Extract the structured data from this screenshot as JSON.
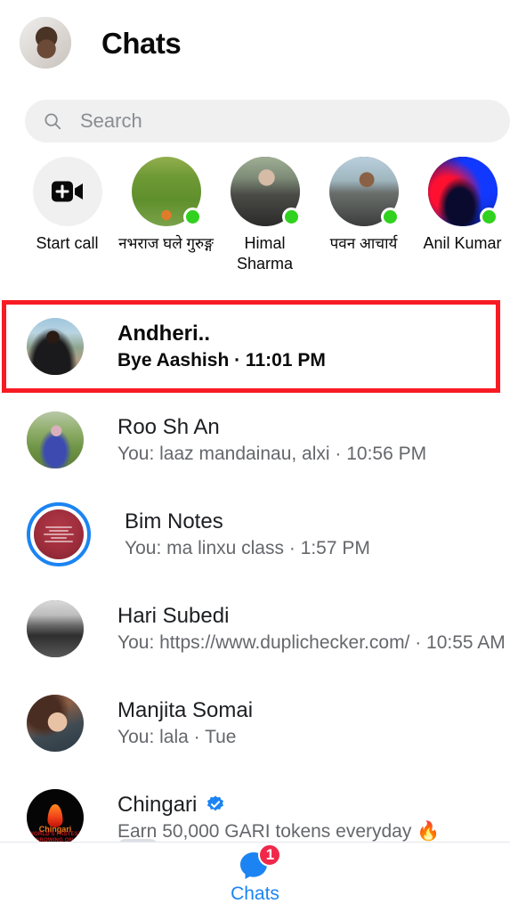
{
  "header": {
    "title": "Chats",
    "avatar_name": "user-profile-photo"
  },
  "search": {
    "placeholder": "Search",
    "icon": "search-icon"
  },
  "calls_row": {
    "items": [
      {
        "label": "Start call",
        "icon": "video-call-plus-icon",
        "online": false,
        "type": "action"
      },
      {
        "label": "नभराज घले गुरुङ्ग",
        "online": true,
        "type": "contact"
      },
      {
        "label": "Himal Sharma",
        "online": true,
        "type": "contact"
      },
      {
        "label": "पवन आचार्य",
        "online": true,
        "type": "contact"
      },
      {
        "label": "Anil Kumar",
        "online": true,
        "type": "contact"
      }
    ]
  },
  "chats": [
    {
      "name": "Andheri..",
      "preview": "Bye Aashish · 11:01 PM",
      "unread": true,
      "ring": false,
      "verified": false,
      "highlighted": true
    },
    {
      "name": "Roo Sh An",
      "preview": "You: laaz mandainau, alxi · 10:56 PM",
      "unread": false,
      "ring": false,
      "verified": false,
      "highlighted": false
    },
    {
      "name": "Bim Notes",
      "preview": "You: ma linxu class · 1:57 PM",
      "unread": false,
      "ring": true,
      "verified": false,
      "highlighted": false,
      "avatar_text": [
        "Today class",
        "schedule",
        "Co class 5:00 PM",
        "Java :-",
        "STAT :- 8:00 PM"
      ]
    },
    {
      "name": "Hari Subedi",
      "preview": "You: https://www.duplichecker.com/ · 10:55 AM",
      "unread": false,
      "ring": false,
      "verified": false,
      "highlighted": false
    },
    {
      "name": "Manjita Somai",
      "preview": "You: lala · Tue",
      "unread": false,
      "ring": false,
      "verified": false,
      "highlighted": false
    },
    {
      "name": "Chingari",
      "preview": "Earn 50,000 GARI tokens everyday 🔥",
      "unread": false,
      "ring": false,
      "verified": true,
      "highlighted": false,
      "avatar_word": "Chingari",
      "avatar_sub": "WORLD'S FASTEST GROWING ON-CHAIN SOCIAL APP"
    }
  ],
  "bottom_nav": {
    "items": [
      {
        "label": "Chats",
        "icon": "chat-bubble-icon",
        "badge": "1",
        "active": true
      }
    ]
  },
  "colors": {
    "accent_blue": "#1b84f2",
    "badge_red": "#f02849",
    "annotation_red": "#f71b24",
    "online_green": "#31d11f",
    "search_bg": "#f0f0f0",
    "text_primary": "#1c1e21",
    "text_secondary": "#65676b"
  }
}
